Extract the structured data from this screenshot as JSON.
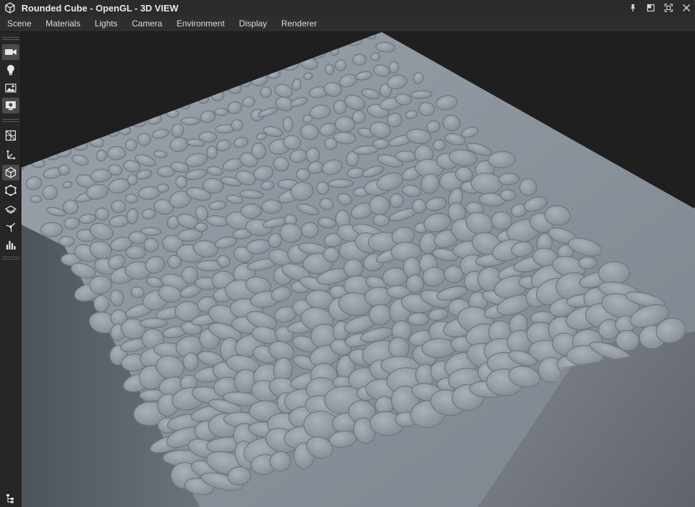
{
  "window": {
    "title": "Rounded Cube - OpenGL - 3D VIEW",
    "app_icon": "cube-icon",
    "controls": [
      "pin-icon",
      "restore-icon",
      "maximize-icon",
      "close-icon"
    ]
  },
  "menu": {
    "items": [
      "Scene",
      "Materials",
      "Lights",
      "Camera",
      "Environment",
      "Display",
      "Renderer"
    ]
  },
  "toolbar": {
    "groups": [
      [
        "camera-icon",
        "light-bulb-icon",
        "environment-image-icon",
        "render-settings-icon"
      ],
      [
        "wireframe-cube-icon",
        "transform-axes-icon",
        "solid-cube-icon",
        "mesh-cube-icon",
        "layers-icon",
        "light-direction-icon",
        "histogram-icon"
      ]
    ],
    "bottom": "scene-tree-icon"
  },
  "viewport": {
    "subject": "rounded-cube",
    "material": "cobblestone"
  }
}
